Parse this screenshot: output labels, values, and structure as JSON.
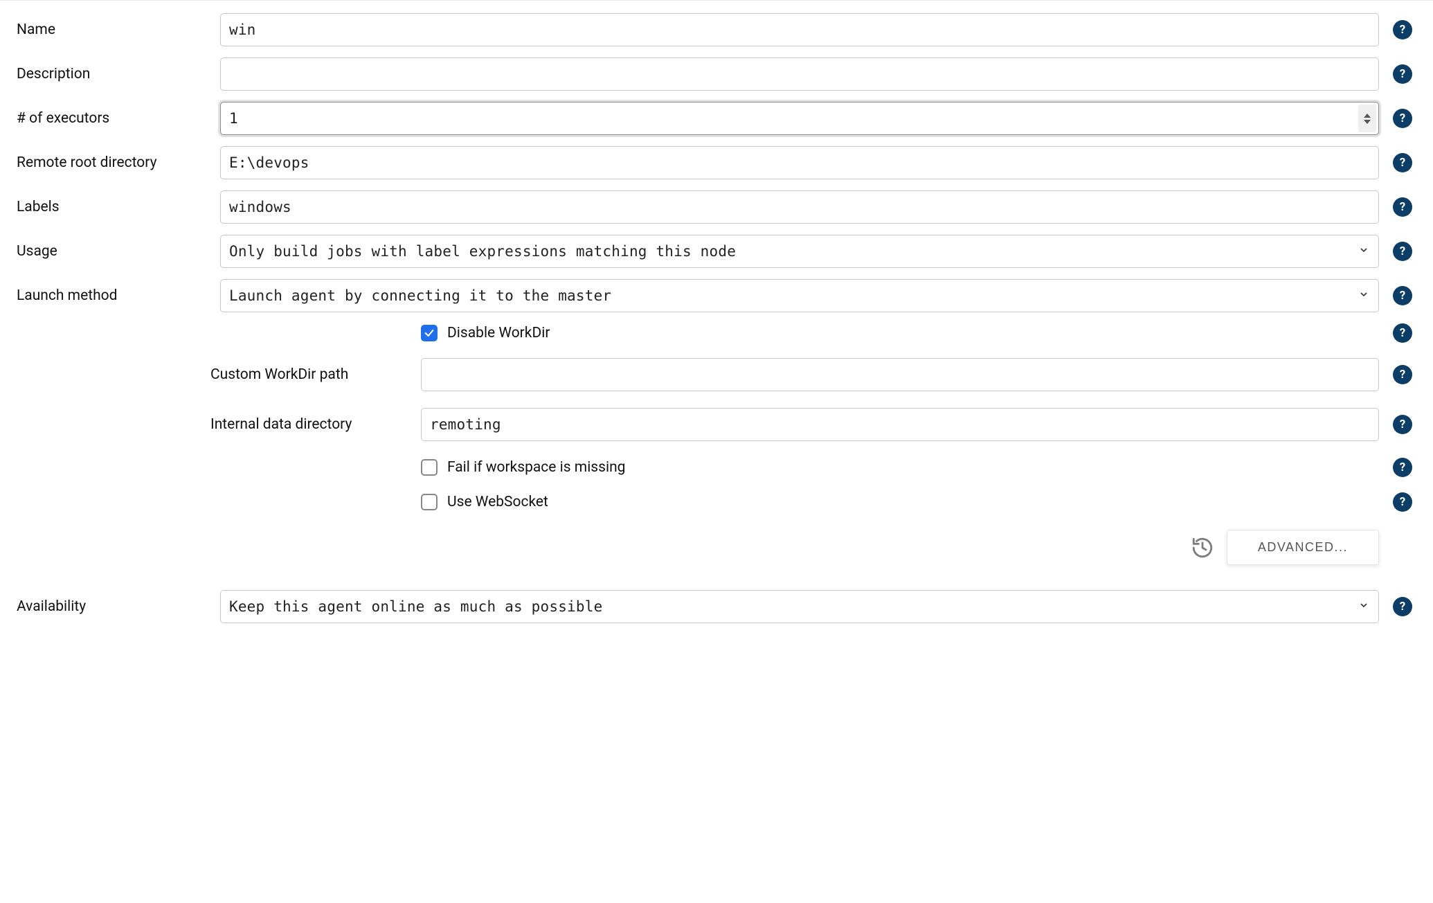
{
  "fields": {
    "name": {
      "label": "Name",
      "value": "win"
    },
    "description": {
      "label": "Description",
      "value": ""
    },
    "executors": {
      "label": "# of executors",
      "value": "1"
    },
    "remoteRoot": {
      "label": "Remote root directory",
      "value": "E:\\devops"
    },
    "labels": {
      "label": "Labels",
      "value": "windows"
    },
    "usage": {
      "label": "Usage",
      "value": "Only build jobs with label expressions matching this node"
    },
    "launch": {
      "label": "Launch method",
      "value": "Launch agent by connecting it to the master"
    },
    "availability": {
      "label": "Availability",
      "value": "Keep this agent online as much as possible"
    }
  },
  "launchSub": {
    "disableWorkDir": {
      "label": "Disable WorkDir",
      "checked": true
    },
    "customWorkDir": {
      "label": "Custom WorkDir path",
      "value": ""
    },
    "internalDataDir": {
      "label": "Internal data directory",
      "value": "remoting"
    },
    "failIfWsMissing": {
      "label": "Fail if workspace is missing",
      "checked": false
    },
    "useWebSocket": {
      "label": "Use WebSocket",
      "checked": false
    }
  },
  "buttons": {
    "advanced": "ADVANCED..."
  },
  "helpGlyph": "?"
}
